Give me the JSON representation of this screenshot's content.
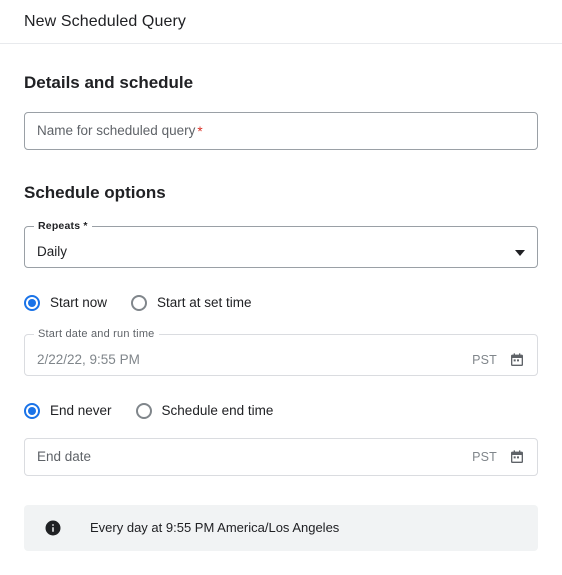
{
  "header": {
    "title": "New Scheduled Query"
  },
  "details_section": {
    "heading": "Details and schedule",
    "name_field": {
      "placeholder": "Name for scheduled query",
      "required_marker": "*",
      "value": ""
    }
  },
  "schedule_section": {
    "heading": "Schedule options",
    "repeats": {
      "label": "Repeats *",
      "selected": "Daily",
      "options": [
        "Daily"
      ],
      "arrow_icon": "chevron-down-icon"
    },
    "start_radio_group": {
      "options": [
        {
          "label": "Start now",
          "checked": true
        },
        {
          "label": "Start at set time",
          "checked": false
        }
      ]
    },
    "start_date_field": {
      "label": "Start date and run time",
      "value": "2/22/22, 9:55 PM",
      "timezone": "PST",
      "calendar_icon": "calendar-icon",
      "disabled": true
    },
    "end_radio_group": {
      "options": [
        {
          "label": "End never",
          "checked": true
        },
        {
          "label": "Schedule end time",
          "checked": false
        }
      ]
    },
    "end_date_field": {
      "placeholder": "End date",
      "value": "",
      "timezone": "PST",
      "calendar_icon": "calendar-icon",
      "disabled": true
    }
  },
  "info_banner": {
    "icon": "info-icon",
    "text": "Every day at 9:55 PM America/Los Angeles"
  },
  "colors": {
    "accent_blue": "#1a73e8",
    "required_red": "#d93025",
    "banner_background": "#f1f3f4",
    "border_default": "#9aa0a6",
    "border_disabled": "#dadce0",
    "text_primary": "#202124",
    "text_secondary": "#5f6368",
    "text_muted": "#80868b"
  }
}
